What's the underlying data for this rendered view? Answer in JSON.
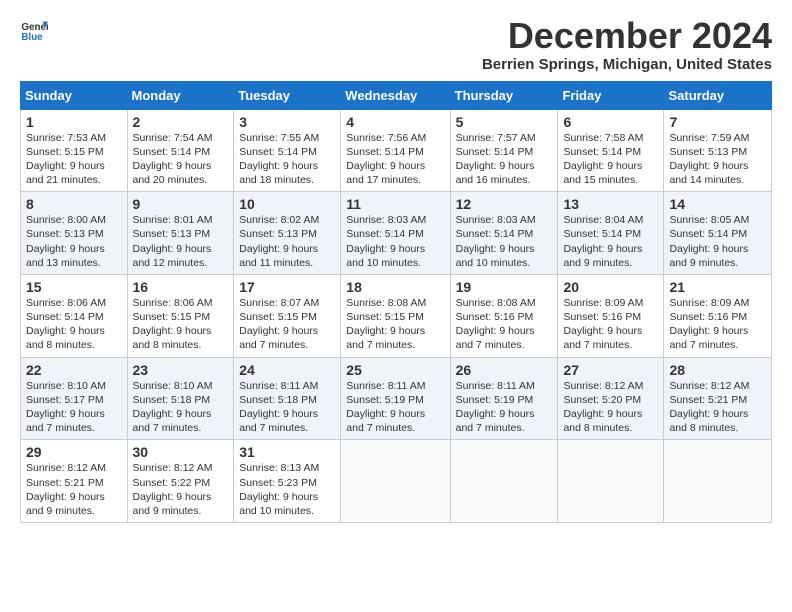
{
  "logo": {
    "line1": "General",
    "line2": "Blue"
  },
  "title": "December 2024",
  "subtitle": "Berrien Springs, Michigan, United States",
  "headers": [
    "Sunday",
    "Monday",
    "Tuesday",
    "Wednesday",
    "Thursday",
    "Friday",
    "Saturday"
  ],
  "weeks": [
    [
      {
        "day": "1",
        "sunrise": "7:53 AM",
        "sunset": "5:15 PM",
        "daylight": "9 hours and 21 minutes."
      },
      {
        "day": "2",
        "sunrise": "7:54 AM",
        "sunset": "5:14 PM",
        "daylight": "9 hours and 20 minutes."
      },
      {
        "day": "3",
        "sunrise": "7:55 AM",
        "sunset": "5:14 PM",
        "daylight": "9 hours and 18 minutes."
      },
      {
        "day": "4",
        "sunrise": "7:56 AM",
        "sunset": "5:14 PM",
        "daylight": "9 hours and 17 minutes."
      },
      {
        "day": "5",
        "sunrise": "7:57 AM",
        "sunset": "5:14 PM",
        "daylight": "9 hours and 16 minutes."
      },
      {
        "day": "6",
        "sunrise": "7:58 AM",
        "sunset": "5:14 PM",
        "daylight": "9 hours and 15 minutes."
      },
      {
        "day": "7",
        "sunrise": "7:59 AM",
        "sunset": "5:13 PM",
        "daylight": "9 hours and 14 minutes."
      }
    ],
    [
      {
        "day": "8",
        "sunrise": "8:00 AM",
        "sunset": "5:13 PM",
        "daylight": "9 hours and 13 minutes."
      },
      {
        "day": "9",
        "sunrise": "8:01 AM",
        "sunset": "5:13 PM",
        "daylight": "9 hours and 12 minutes."
      },
      {
        "day": "10",
        "sunrise": "8:02 AM",
        "sunset": "5:13 PM",
        "daylight": "9 hours and 11 minutes."
      },
      {
        "day": "11",
        "sunrise": "8:03 AM",
        "sunset": "5:14 PM",
        "daylight": "9 hours and 10 minutes."
      },
      {
        "day": "12",
        "sunrise": "8:03 AM",
        "sunset": "5:14 PM",
        "daylight": "9 hours and 10 minutes."
      },
      {
        "day": "13",
        "sunrise": "8:04 AM",
        "sunset": "5:14 PM",
        "daylight": "9 hours and 9 minutes."
      },
      {
        "day": "14",
        "sunrise": "8:05 AM",
        "sunset": "5:14 PM",
        "daylight": "9 hours and 9 minutes."
      }
    ],
    [
      {
        "day": "15",
        "sunrise": "8:06 AM",
        "sunset": "5:14 PM",
        "daylight": "9 hours and 8 minutes."
      },
      {
        "day": "16",
        "sunrise": "8:06 AM",
        "sunset": "5:15 PM",
        "daylight": "9 hours and 8 minutes."
      },
      {
        "day": "17",
        "sunrise": "8:07 AM",
        "sunset": "5:15 PM",
        "daylight": "9 hours and 7 minutes."
      },
      {
        "day": "18",
        "sunrise": "8:08 AM",
        "sunset": "5:15 PM",
        "daylight": "9 hours and 7 minutes."
      },
      {
        "day": "19",
        "sunrise": "8:08 AM",
        "sunset": "5:16 PM",
        "daylight": "9 hours and 7 minutes."
      },
      {
        "day": "20",
        "sunrise": "8:09 AM",
        "sunset": "5:16 PM",
        "daylight": "9 hours and 7 minutes."
      },
      {
        "day": "21",
        "sunrise": "8:09 AM",
        "sunset": "5:16 PM",
        "daylight": "9 hours and 7 minutes."
      }
    ],
    [
      {
        "day": "22",
        "sunrise": "8:10 AM",
        "sunset": "5:17 PM",
        "daylight": "9 hours and 7 minutes."
      },
      {
        "day": "23",
        "sunrise": "8:10 AM",
        "sunset": "5:18 PM",
        "daylight": "9 hours and 7 minutes."
      },
      {
        "day": "24",
        "sunrise": "8:11 AM",
        "sunset": "5:18 PM",
        "daylight": "9 hours and 7 minutes."
      },
      {
        "day": "25",
        "sunrise": "8:11 AM",
        "sunset": "5:19 PM",
        "daylight": "9 hours and 7 minutes."
      },
      {
        "day": "26",
        "sunrise": "8:11 AM",
        "sunset": "5:19 PM",
        "daylight": "9 hours and 7 minutes."
      },
      {
        "day": "27",
        "sunrise": "8:12 AM",
        "sunset": "5:20 PM",
        "daylight": "9 hours and 8 minutes."
      },
      {
        "day": "28",
        "sunrise": "8:12 AM",
        "sunset": "5:21 PM",
        "daylight": "9 hours and 8 minutes."
      }
    ],
    [
      {
        "day": "29",
        "sunrise": "8:12 AM",
        "sunset": "5:21 PM",
        "daylight": "9 hours and 9 minutes."
      },
      {
        "day": "30",
        "sunrise": "8:12 AM",
        "sunset": "5:22 PM",
        "daylight": "9 hours and 9 minutes."
      },
      {
        "day": "31",
        "sunrise": "8:13 AM",
        "sunset": "5:23 PM",
        "daylight": "9 hours and 10 minutes."
      },
      null,
      null,
      null,
      null
    ]
  ],
  "labels": {
    "sunrise": "Sunrise:",
    "sunset": "Sunset:",
    "daylight": "Daylight:"
  }
}
